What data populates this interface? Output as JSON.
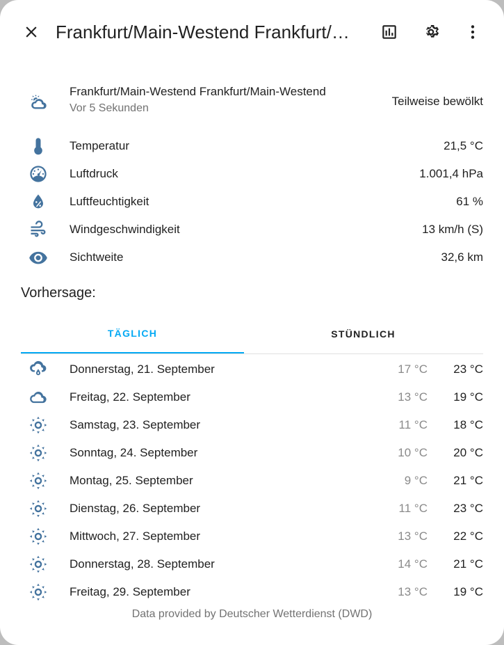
{
  "header": {
    "title": "Frankfurt/Main-Westend Frankfurt/Main-Westend"
  },
  "current": {
    "name": "Frankfurt/Main-Westend Frankfurt/Main-Westend",
    "updated": "Vor 5 Sekunden",
    "condition": "Teilweise bewölkt",
    "icon": "partly-cloudy-icon"
  },
  "attributes": [
    {
      "label": "Temperatur",
      "value": "21,5 °C",
      "icon": "thermometer-icon"
    },
    {
      "label": "Luftdruck",
      "value": "1.001,4 hPa",
      "icon": "gauge-icon"
    },
    {
      "label": "Luftfeuchtigkeit",
      "value": "61 %",
      "icon": "water-percent-icon"
    },
    {
      "label": "Windgeschwindigkeit",
      "value": "13 km/h (S)",
      "icon": "wind-icon"
    },
    {
      "label": "Sichtweite",
      "value": "32,6 km",
      "icon": "eye-icon"
    }
  ],
  "forecast": {
    "heading": "Vorhersage:",
    "tabs": [
      {
        "label": "TÄGLICH",
        "active": true
      },
      {
        "label": "STÜNDLICH",
        "active": false
      }
    ],
    "days": [
      {
        "date": "Donnerstag, 21. September",
        "low": "17 °C",
        "high": "23 °C",
        "icon": "rainy-icon"
      },
      {
        "date": "Freitag, 22. September",
        "low": "13 °C",
        "high": "19 °C",
        "icon": "cloudy-icon"
      },
      {
        "date": "Samstag, 23. September",
        "low": "11 °C",
        "high": "18 °C",
        "icon": "sunny-icon"
      },
      {
        "date": "Sonntag, 24. September",
        "low": "10 °C",
        "high": "20 °C",
        "icon": "sunny-icon"
      },
      {
        "date": "Montag, 25. September",
        "low": "9 °C",
        "high": "21 °C",
        "icon": "sunny-icon"
      },
      {
        "date": "Dienstag, 26. September",
        "low": "11 °C",
        "high": "23 °C",
        "icon": "sunny-icon"
      },
      {
        "date": "Mittwoch, 27. September",
        "low": "13 °C",
        "high": "22 °C",
        "icon": "sunny-icon"
      },
      {
        "date": "Donnerstag, 28. September",
        "low": "14 °C",
        "high": "21 °C",
        "icon": "sunny-icon"
      },
      {
        "date": "Freitag, 29. September",
        "low": "13 °C",
        "high": "19 °C",
        "icon": "sunny-icon"
      }
    ]
  },
  "attribution": "Data provided by Deutscher Wetterdienst (DWD)",
  "colors": {
    "accent": "#03a9f4",
    "icon": "#44739e"
  }
}
